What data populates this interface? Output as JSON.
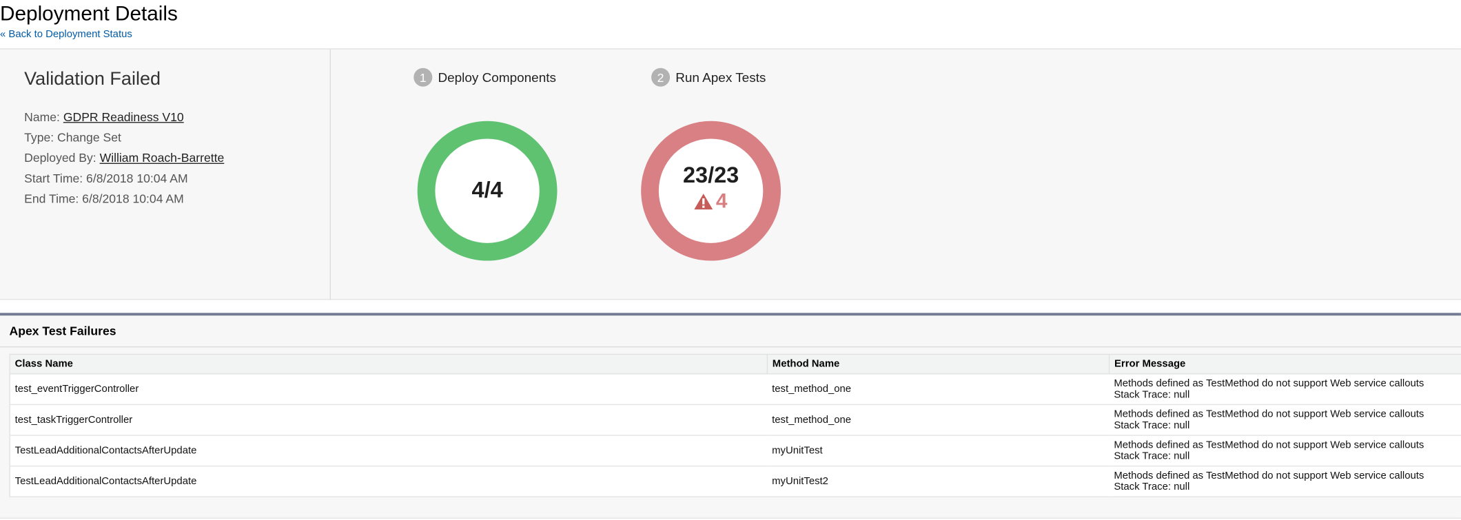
{
  "header": {
    "title": "Deployment Details",
    "back_link": "« Back to Deployment Status"
  },
  "summary": {
    "status": "Validation Failed",
    "name_label": "Name:",
    "name_value": "GDPR Readiness V10",
    "type_label": "Type:",
    "type_value": "Change Set",
    "deployed_by_label": "Deployed By:",
    "deployed_by_value": "William Roach-Barrette",
    "start_label": "Start Time:",
    "start_value": "6/8/2018 10:04 AM",
    "end_label": "End Time:",
    "end_value": "6/8/2018 10:04 AM"
  },
  "steps": [
    {
      "number": "1",
      "label": "Deploy Components",
      "count": "4/4",
      "color": "#5fc271"
    },
    {
      "number": "2",
      "label": "Run Apex Tests",
      "count": "23/23",
      "failures": "4",
      "color": "#d88084",
      "warning_icon": "warning-triangle-icon"
    }
  ],
  "failures": {
    "title": "Apex Test Failures",
    "columns": [
      "Class Name",
      "Method Name",
      "Error Message"
    ],
    "rows": [
      {
        "class": "test_eventTriggerController",
        "method": "test_method_one",
        "error": "Methods defined as TestMethod do not support Web service callouts",
        "trace": "Stack Trace: null"
      },
      {
        "class": "test_taskTriggerController",
        "method": "test_method_one",
        "error": "Methods defined as TestMethod do not support Web service callouts",
        "trace": "Stack Trace: null"
      },
      {
        "class": "TestLeadAdditionalContactsAfterUpdate",
        "method": "myUnitTest",
        "error": "Methods defined as TestMethod do not support Web service callouts",
        "trace": "Stack Trace: null"
      },
      {
        "class": "TestLeadAdditionalContactsAfterUpdate",
        "method": "myUnitTest2",
        "error": "Methods defined as TestMethod do not support Web service callouts",
        "trace": "Stack Trace: null"
      }
    ]
  }
}
